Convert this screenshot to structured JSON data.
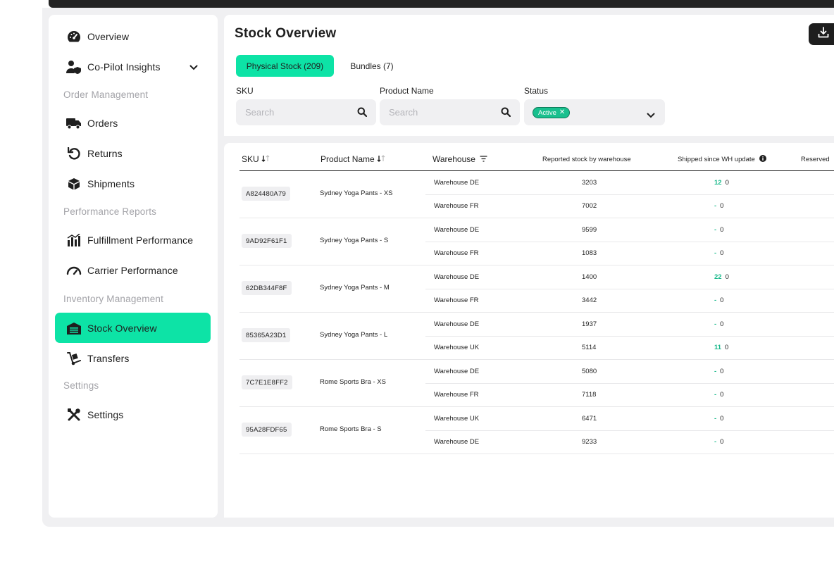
{
  "sidebar": {
    "items": [
      {
        "label": "Overview"
      },
      {
        "label": "Co-Pilot Insights"
      },
      {
        "label": "Orders"
      },
      {
        "label": "Returns"
      },
      {
        "label": "Shipments"
      },
      {
        "label": "Fulfillment Performance"
      },
      {
        "label": "Carrier Performance"
      },
      {
        "label": "Stock Overview"
      },
      {
        "label": "Transfers"
      },
      {
        "label": "Settings"
      }
    ],
    "sections": [
      "Order Management",
      "Performance Reports",
      "Inventory Management",
      "Settings"
    ],
    "active_item": "Stock Overview"
  },
  "header": {
    "title": "Stock Overview"
  },
  "tabs": [
    {
      "label": "Physical Stock (209)"
    },
    {
      "label": "Bundles (7)"
    }
  ],
  "filters": {
    "sku_label": "SKU",
    "sku_placeholder": "Search",
    "product_label": "Product Name",
    "product_placeholder": "Search",
    "status_label": "Status",
    "status_chip": "Active"
  },
  "table": {
    "headers": {
      "sku": "SKU",
      "product": "Product Name",
      "warehouse": "Warehouse",
      "reported": "Reported stock by warehouse",
      "shipped": "Shipped since WH update",
      "reserved": "Reserved"
    },
    "products": [
      {
        "sku": "A824480A79",
        "name": "Sydney Yoga Pants - XS",
        "rows": [
          {
            "warehouse": "Warehouse DE",
            "stock": "3203",
            "shipped": "12",
            "value": "0"
          },
          {
            "warehouse": "Warehouse FR",
            "stock": "7002",
            "shipped": "-",
            "value": "0"
          }
        ]
      },
      {
        "sku": "9AD92F61F1",
        "name": "Sydney Yoga Pants - S",
        "rows": [
          {
            "warehouse": "Warehouse DE",
            "stock": "9599",
            "shipped": "-",
            "value": "0"
          },
          {
            "warehouse": "Warehouse FR",
            "stock": "1083",
            "shipped": "-",
            "value": "0"
          }
        ]
      },
      {
        "sku": "62DB344F8F",
        "name": "Sydney Yoga Pants - M",
        "rows": [
          {
            "warehouse": "Warehouse DE",
            "stock": "1400",
            "shipped": "22",
            "value": "0"
          },
          {
            "warehouse": "Warehouse FR",
            "stock": "3442",
            "shipped": "-",
            "value": "0"
          }
        ]
      },
      {
        "sku": "85365A23D1",
        "name": "Sydney Yoga Pants - L",
        "rows": [
          {
            "warehouse": "Warehouse DE",
            "stock": "1937",
            "shipped": "-",
            "value": "0"
          },
          {
            "warehouse": "Warehouse UK",
            "stock": "5114",
            "shipped": "11",
            "value": "0"
          }
        ]
      },
      {
        "sku": "7C7E1E8FF2",
        "name": "Rome Sports Bra - XS",
        "rows": [
          {
            "warehouse": "Warehouse DE",
            "stock": "5080",
            "shipped": "-",
            "value": "0"
          },
          {
            "warehouse": "Warehouse FR",
            "stock": "7118",
            "shipped": "-",
            "value": "0"
          }
        ]
      },
      {
        "sku": "95A28FDF65",
        "name": "Rome Sports Bra - S",
        "rows": [
          {
            "warehouse": "Warehouse UK",
            "stock": "6471",
            "shipped": "-",
            "value": "0"
          },
          {
            "warehouse": "Warehouse DE",
            "stock": "9233",
            "shipped": "-",
            "value": "0"
          }
        ]
      }
    ]
  },
  "colors": {
    "accent": "#0de3a6",
    "accent_text": "#18b98a",
    "dark": "#1e1e1e",
    "background": "#f0f0f2"
  },
  "icons": [
    "dashboard-gauge-icon",
    "user-shield-icon",
    "chevron-down-icon",
    "truck-icon",
    "return-arrow-icon",
    "box-icon",
    "bar-chart-icon",
    "speedometer-icon",
    "warehouse-icon",
    "hand-truck-icon",
    "tools-icon",
    "download-icon",
    "search-icon",
    "sort-icon",
    "filter-icon",
    "info-icon"
  ]
}
